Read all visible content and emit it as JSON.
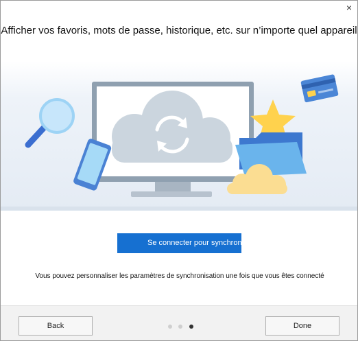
{
  "dialog": {
    "close_glyph": "×",
    "title": "Afficher vos favoris, mots de passe, historique, etc. sur n’importe quel appareil",
    "connect_button": "Se connecter pour synchronis",
    "info_text": "Vous pouvez personnaliser les paramètres de synchronisation une fois que vous êtes connecté"
  },
  "footer": {
    "back_label": "Back",
    "done_label": "Done",
    "pagination": {
      "total": 3,
      "active_index": 2
    }
  },
  "colors": {
    "accent": "#1670d1",
    "illustration_bg": "#e8eef6",
    "cloud": "#cfd8e0",
    "star": "#ffd24d"
  },
  "icons": [
    "close-icon",
    "magnifier-icon",
    "phone-icon",
    "monitor-icon",
    "sync-icon",
    "star-icon",
    "credit-card-icon",
    "folder-icon",
    "cloud-icon"
  ]
}
